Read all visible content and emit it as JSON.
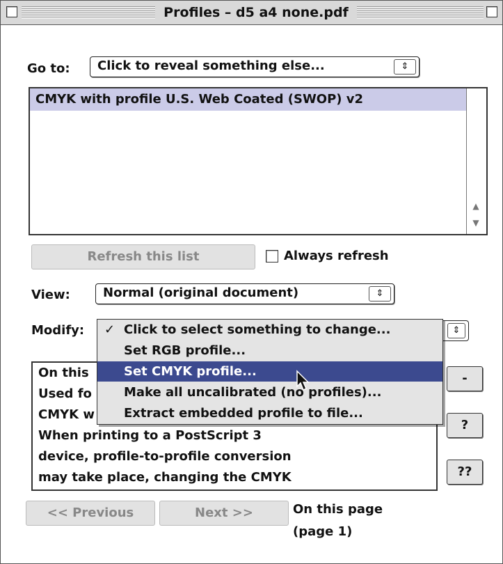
{
  "window": {
    "title": "Profiles – d5 a4 none.pdf"
  },
  "goto": {
    "label": "Go to:",
    "value": "Click to reveal something else...",
    "arrow": "⇕"
  },
  "profiles_list": {
    "items": [
      "CMYK with profile U.S. Web Coated (SWOP) v2"
    ]
  },
  "refresh": {
    "button_label": "Refresh this list",
    "always_label": "Always refresh",
    "always_checked": false
  },
  "view": {
    "label": "View:",
    "value": "Normal (original document)",
    "arrow": "⇕"
  },
  "modify": {
    "label": "Modify:",
    "arrow": "⇕",
    "menu_items": [
      {
        "label": "Click to select something to change...",
        "checked": true,
        "mark": "✓"
      },
      {
        "label": "Set RGB profile...",
        "checked": false
      },
      {
        "label": "Set CMYK profile...",
        "checked": false,
        "highlighted": true
      },
      {
        "label": "Make all uncalibrated (no profiles)...",
        "checked": false
      },
      {
        "label": "Extract embedded profile to file...",
        "checked": false
      }
    ]
  },
  "info_text": {
    "lines": [
      "On this",
      "Used fo",
      "CMYK w",
      "When printing to a PostScript 3",
      "device, profile-to-profile conversion",
      "may take place, changing the CMYK"
    ]
  },
  "side_buttons": {
    "minus": "-",
    "question": "?",
    "double_question": "??"
  },
  "nav": {
    "prev_label": "<< Previous",
    "next_label": "Next >>",
    "page_line1": "On this page",
    "page_line2": "(page 1)"
  }
}
